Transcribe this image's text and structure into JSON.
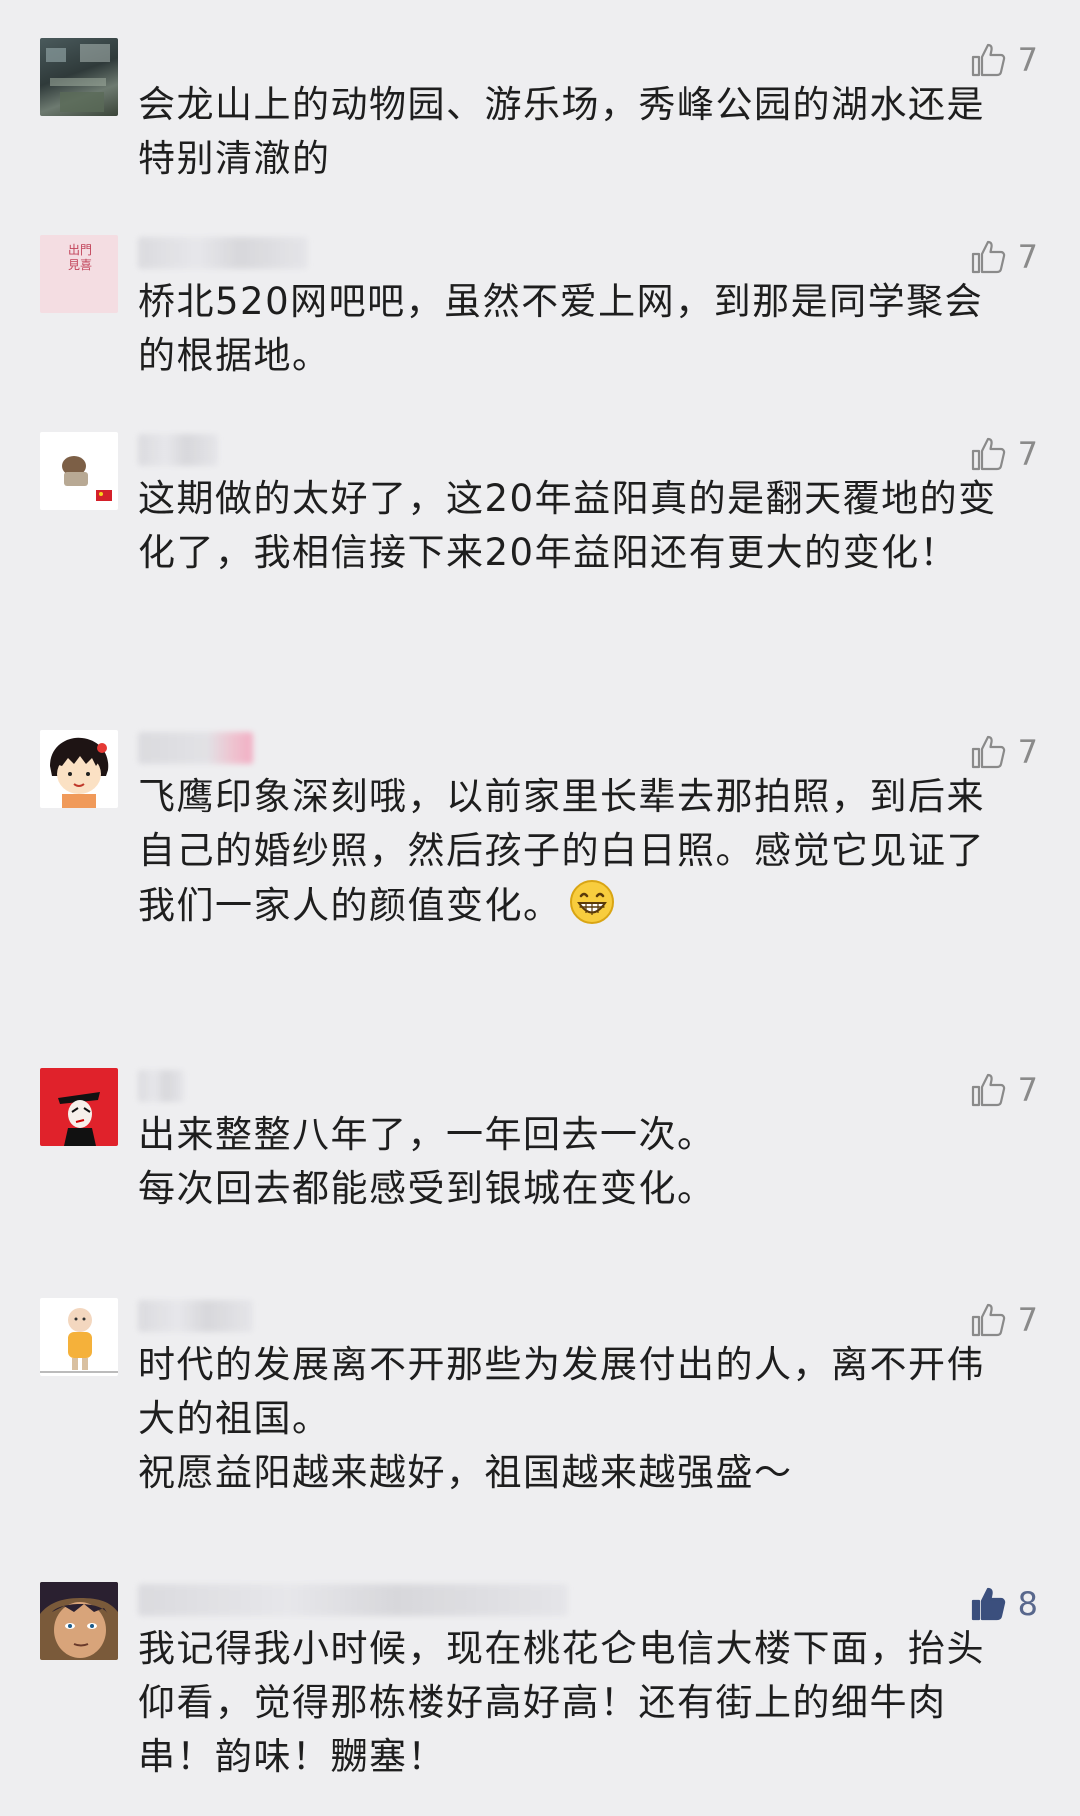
{
  "comments": [
    {
      "likes": "7",
      "text": "会龙山上的动物园、游乐场，秀峰公园的湖水还是\n特别清澈的"
    },
    {
      "likes": "7",
      "text": "桥北520网吧吧，虽然不爱上网，到那是同学聚会\n的根据地。",
      "avatar_text": "出門\n見喜"
    },
    {
      "likes": "7",
      "text": "这期做的太好了，这20年益阳真的是翻天覆地的变\n化了，我相信接下来20年益阳还有更大的变化！"
    },
    {
      "likes": "7",
      "text": "飞鹰印象深刻哦，以前家里长辈去那拍照，到后来\n自己的婚纱照，然后孩子的白日照。感觉它见证了\n我们一家人的颜值变化。",
      "emoji": "grinning-face"
    },
    {
      "likes": "7",
      "text": "出来整整八年了，一年回去一次。\n每次回去都能感受到银城在变化。"
    },
    {
      "likes": "7",
      "text": "时代的发展离不开那些为发展付出的人，离不开伟\n大的祖国。\n祝愿益阳越来越好，祖国越来越强盛～"
    },
    {
      "likes": "8",
      "liked": true,
      "text": "我记得我小时候，现在桃花仑电信大楼下面，抬头\n仰看，觉得那栋楼好高好高！还有街上的细牛肉\n串！韵味！嬲塞！"
    }
  ],
  "icons": {
    "like": "thumbs-up-icon",
    "liked_color": "#3b4f7d",
    "unliked_color": "#8a8a8a"
  }
}
